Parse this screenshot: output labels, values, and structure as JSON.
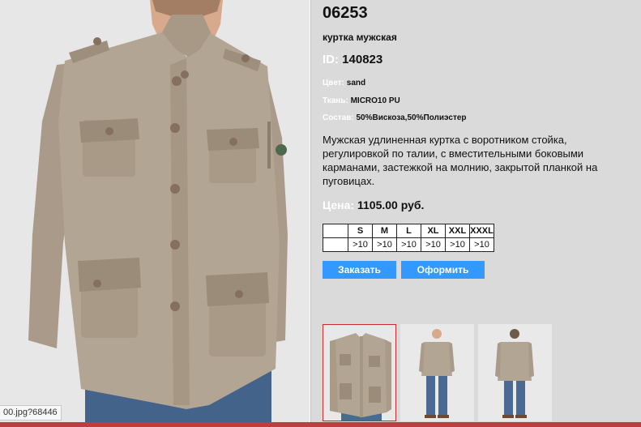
{
  "product": {
    "code": "06253",
    "subtitle": "куртка мужская",
    "id_label": "ID:",
    "id_value": "140823",
    "color_label": "Цвет:",
    "color_value": "sand",
    "fabric_label": "Ткань:",
    "fabric_value": "MICRO10 PU",
    "composition_label": "Состав:",
    "composition_value": "50%Вискоза,50%Полиэстер",
    "description": "Мужская удлиненная куртка с воротником стойка, регулировкой по талии, с вместительными боковыми карманами, застежкой на молнию, закрытой планкой  на пуговицах.",
    "price_label": "Цена:",
    "price_value": "1105.00 руб."
  },
  "sizes": {
    "headers": [
      "S",
      "M",
      "L",
      "XL",
      "XXL",
      "XXXL"
    ],
    "stock": [
      ">10",
      ">10",
      ">10",
      ">10",
      ">10",
      ">10"
    ]
  },
  "buttons": {
    "order": "Заказать",
    "checkout": "Оформить"
  },
  "status_url": "00.jpg?68446",
  "colors": {
    "accent": "#3399ff",
    "jacket": "#b3a594",
    "panel": "#dadada",
    "selected_border": "#cc2b2b"
  },
  "thumbnails": [
    {
      "name": "front-closeup",
      "selected": true
    },
    {
      "name": "full-front",
      "selected": false
    },
    {
      "name": "full-back",
      "selected": false
    }
  ]
}
